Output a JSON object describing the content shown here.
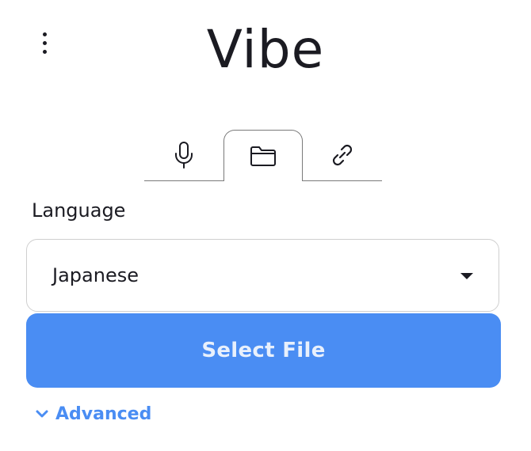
{
  "app": {
    "title": "Vibe"
  },
  "tabs": [
    {
      "name": "microphone",
      "icon": "microphone-icon",
      "active": false
    },
    {
      "name": "file",
      "icon": "folder-icon",
      "active": true
    },
    {
      "name": "link",
      "icon": "link-icon",
      "active": false
    }
  ],
  "language": {
    "label": "Language",
    "selected": "Japanese"
  },
  "actions": {
    "select_file_label": "Select File",
    "advanced_label": "Advanced"
  },
  "colors": {
    "accent": "#4a8df3",
    "text": "#1b1b22",
    "border": "#cfcfcf"
  }
}
